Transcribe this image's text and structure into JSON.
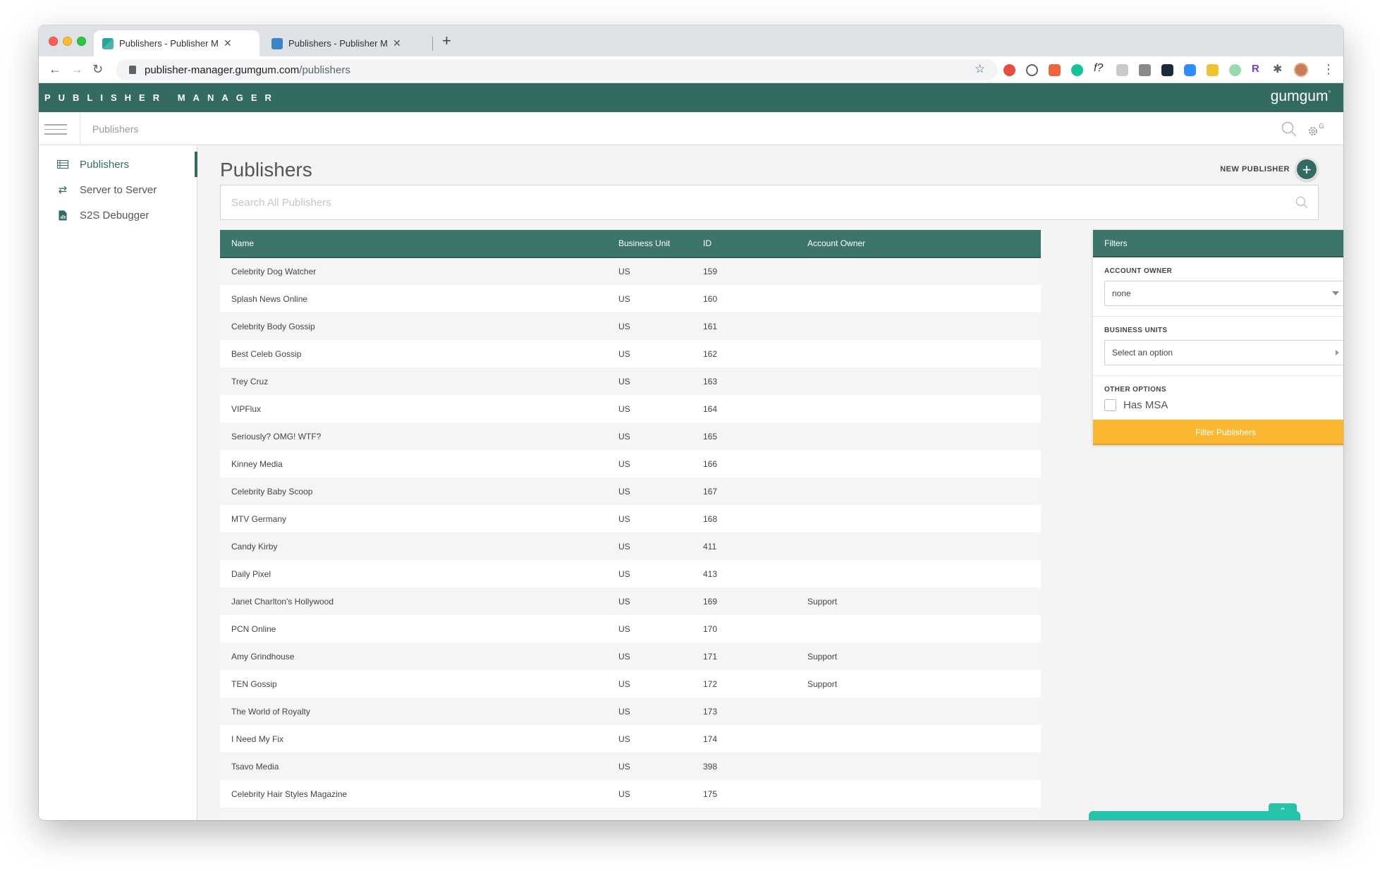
{
  "browser": {
    "tabs": [
      {
        "title": "Publishers - Publisher Manager",
        "active": true
      },
      {
        "title": "Publishers - Publisher Manager",
        "active": false
      }
    ],
    "url_host": "publisher-manager.gumgum.com",
    "url_path": "/publishers",
    "extension_icons": [
      "badge-2-icon",
      "circle-icon",
      "chart-icon",
      "grammarly-icon",
      "formula-icon",
      "document-icon",
      "camera-icon",
      "react-icon",
      "zoom-icon",
      "badge-1-icon",
      "leaf-icon",
      "r-icon",
      "puzzle-icon"
    ]
  },
  "app": {
    "brand": "PUBLISHER MANAGER",
    "logo": "gumgum"
  },
  "breadcrumb": "Publishers",
  "sidebar": {
    "items": [
      {
        "label": "Publishers",
        "icon": "table-icon",
        "active": true
      },
      {
        "label": "Server to Server",
        "icon": "arrows-swap-icon",
        "active": false
      },
      {
        "label": "S2S Debugger",
        "icon": "report-icon",
        "active": false
      }
    ]
  },
  "main": {
    "title": "Publishers",
    "new_publisher_label": "NEW PUBLISHER",
    "search_placeholder": "Search All Publishers"
  },
  "table": {
    "headers": {
      "name": "Name",
      "business_unit": "Business Unit",
      "id": "ID",
      "account_owner": "Account Owner"
    },
    "rows": [
      {
        "name": "Celebrity Dog Watcher",
        "bu": "US",
        "id": "159",
        "owner": ""
      },
      {
        "name": "Splash News Online",
        "bu": "US",
        "id": "160",
        "owner": ""
      },
      {
        "name": "Celebrity Body Gossip",
        "bu": "US",
        "id": "161",
        "owner": ""
      },
      {
        "name": "Best Celeb Gossip",
        "bu": "US",
        "id": "162",
        "owner": ""
      },
      {
        "name": "Trey Cruz",
        "bu": "US",
        "id": "163",
        "owner": ""
      },
      {
        "name": "VIPFlux",
        "bu": "US",
        "id": "164",
        "owner": ""
      },
      {
        "name": "Seriously? OMG! WTF?",
        "bu": "US",
        "id": "165",
        "owner": ""
      },
      {
        "name": "Kinney Media",
        "bu": "US",
        "id": "166",
        "owner": ""
      },
      {
        "name": "Celebrity Baby Scoop",
        "bu": "US",
        "id": "167",
        "owner": ""
      },
      {
        "name": "MTV Germany",
        "bu": "US",
        "id": "168",
        "owner": ""
      },
      {
        "name": "Candy Kirby",
        "bu": "US",
        "id": "411",
        "owner": ""
      },
      {
        "name": "Daily Pixel",
        "bu": "US",
        "id": "413",
        "owner": ""
      },
      {
        "name": "Janet Charlton's Hollywood",
        "bu": "US",
        "id": "169",
        "owner": "Support"
      },
      {
        "name": "PCN Online",
        "bu": "US",
        "id": "170",
        "owner": ""
      },
      {
        "name": "Amy Grindhouse",
        "bu": "US",
        "id": "171",
        "owner": "Support"
      },
      {
        "name": "TEN Gossip",
        "bu": "US",
        "id": "172",
        "owner": "Support"
      },
      {
        "name": "The World of Royalty",
        "bu": "US",
        "id": "173",
        "owner": ""
      },
      {
        "name": "I Need My Fix",
        "bu": "US",
        "id": "174",
        "owner": ""
      },
      {
        "name": "Tsavo Media",
        "bu": "US",
        "id": "398",
        "owner": ""
      },
      {
        "name": "Celebrity Hair Styles Magazine",
        "bu": "US",
        "id": "175",
        "owner": ""
      },
      {
        "name": "",
        "bu": "",
        "id": "",
        "owner": ""
      }
    ]
  },
  "filters": {
    "title": "Filters",
    "account_owner_label": "ACCOUNT OWNER",
    "account_owner_value": "none",
    "business_units_label": "BUSINESS UNITS",
    "business_units_value": "Select an option",
    "other_options_label": "OTHER OPTIONS",
    "has_msa_label": "Has MSA",
    "has_msa_checked": false,
    "button_label": "Filter Publishers"
  },
  "colors": {
    "primary": "#336b63",
    "table_header": "#3c756b",
    "accent_button": "#fbb731",
    "chat": "#26c2a9"
  }
}
